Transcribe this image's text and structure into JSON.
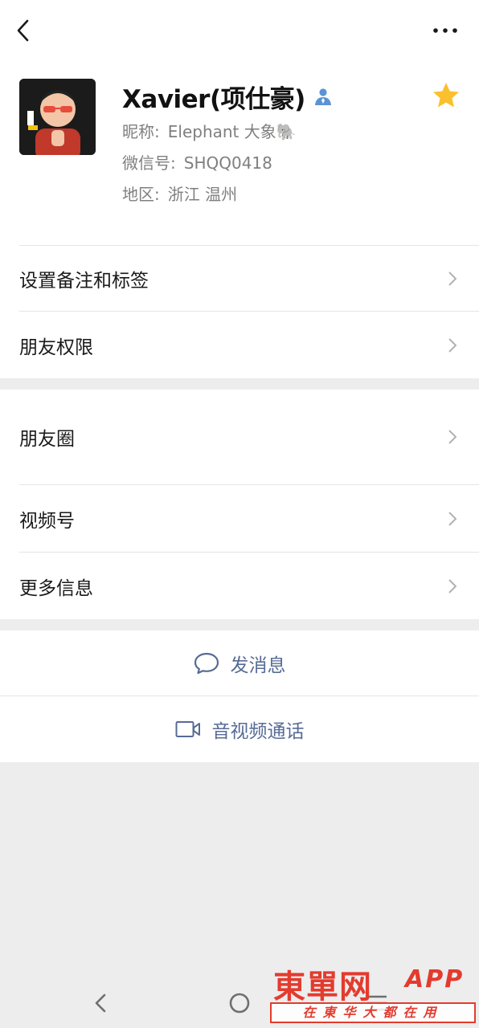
{
  "profile": {
    "name": "Xavier(项仕豪)",
    "nickname_label": "昵称:",
    "nickname_value": "Elephant 大象🐘",
    "wechat_id_label": "微信号:",
    "wechat_id_value": "SHQQ0418",
    "region_label": "地区:",
    "region_value": "浙江  温州",
    "starred": true
  },
  "menu1": {
    "remark": "设置备注和标签",
    "permissions": "朋友权限"
  },
  "menu2": {
    "moments": "朋友圈",
    "channels": "视频号",
    "more_info": "更多信息"
  },
  "actions": {
    "message": "发消息",
    "call": "音视频通话"
  },
  "watermark": {
    "main": "東單网",
    "app": "APP",
    "sub": "在東华大都在用"
  },
  "colors": {
    "accent_link": "#576b95",
    "star": "#fbc02d",
    "background": "#ededed",
    "watermark": "#e33b2e"
  }
}
